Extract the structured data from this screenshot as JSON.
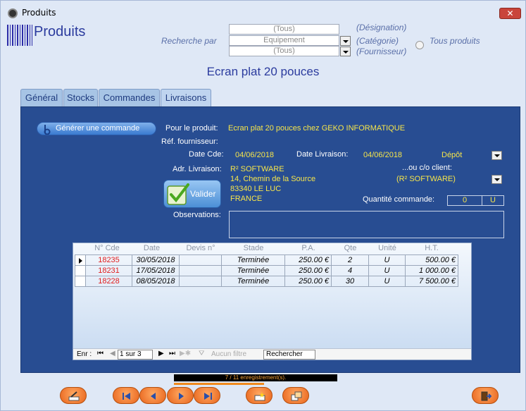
{
  "window": {
    "title": "Produits",
    "close_label": "✕"
  },
  "header": {
    "title": "Produits"
  },
  "search": {
    "label": "Recherche par",
    "designation_value": "(Tous)",
    "designation_caption": "(Désignation)",
    "category_value": "Equipement",
    "category_caption": "(Catégorie)",
    "supplier_value": "(Tous)",
    "supplier_caption": "(Fournisseur)",
    "all_products_label": "Tous produits"
  },
  "product_name": "Ecran plat 20 pouces",
  "tabs": [
    {
      "label": "Général"
    },
    {
      "label": "Stocks"
    },
    {
      "label": "Commandes"
    },
    {
      "label": "Livraisons"
    }
  ],
  "order_form": {
    "generate_button": "Générer une commande",
    "for_product_label": "Pour le produit:",
    "for_product_value": "Ecran plat 20 pouces chez GEKO INFORMATIQUE",
    "supplier_ref_label": "Réf. fournisseur:",
    "order_date_label": "Date Cde:",
    "order_date_value": "04/06/2018",
    "delivery_date_label": "Date Livraison:",
    "delivery_date_value": "04/06/2018",
    "depot_value": "Dépôt",
    "delivery_address_label": "Adr. Livraison:",
    "address_lines": [
      "R² SOFTWARE",
      "14, Chemin de la Source",
      "83340 LE LUC",
      "FRANCE"
    ],
    "client_label": "...ou c/o client:",
    "client_value": "(R² SOFTWARE)",
    "validate_button": "Valider",
    "quantity_label": "Quantité commande:",
    "quantity_value": "0",
    "unit_value": "U",
    "observations_label": "Observations:"
  },
  "orders_table": {
    "columns": [
      "N° Cde",
      "Date",
      "Devis n°",
      "Stade",
      "P.A.",
      "Qte",
      "Unité",
      "H.T."
    ],
    "rows": [
      {
        "num": "18235",
        "date": "30/05/2018",
        "devis": "",
        "stade": "Terminée",
        "pa": "250.00 €",
        "qte": "2",
        "unite": "U",
        "ht": "500.00 €"
      },
      {
        "num": "18231",
        "date": "17/05/2018",
        "devis": "",
        "stade": "Terminée",
        "pa": "250.00 €",
        "qte": "4",
        "unite": "U",
        "ht": "1 000.00 €"
      },
      {
        "num": "18228",
        "date": "08/05/2018",
        "devis": "",
        "stade": "Terminée",
        "pa": "250.00 €",
        "qte": "30",
        "unite": "U",
        "ht": "7 500.00 €"
      }
    ],
    "nav_label": "Enr :",
    "nav_position": "1 sur 3",
    "no_filter_label": "Aucun filtre",
    "search_label": "Rechercher"
  },
  "status_bar": {
    "text": "7 / 11 enregistrement(s).",
    "progress_fraction": 0.55
  },
  "colors": {
    "panel": "#284d92",
    "accent_yellow": "#f6e54a",
    "order_number_red": "#e02020",
    "button_orange": "#e8631c"
  }
}
